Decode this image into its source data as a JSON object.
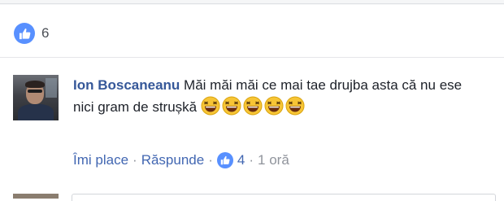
{
  "reactions": {
    "like_count": "6",
    "icon": "like-thumb-icon"
  },
  "comment": {
    "author": "Ion Boscaneanu",
    "text": "Măi măi măi ce mai tae drujba asta că nu ese nici gram de strușkă",
    "emojis": [
      "laughing-emoji",
      "laughing-emoji",
      "laughing-emoji",
      "laughing-emoji",
      "laughing-emoji"
    ],
    "actions": {
      "like": "Îmi place",
      "reply": "Răspunde",
      "like_count": "4",
      "time": "1 oră"
    }
  },
  "colors": {
    "accent": "#4267b2",
    "author": "#365899",
    "like_badge": "#5890ff",
    "muted": "#90949c"
  }
}
